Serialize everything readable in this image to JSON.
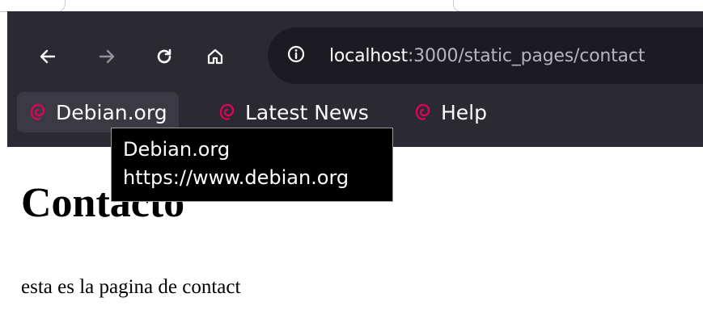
{
  "toolbar": {
    "back_icon": "arrow-left-icon",
    "forward_icon": "arrow-right-icon",
    "reload_icon": "reload-icon",
    "home_icon": "home-icon",
    "site_info_icon": "info-icon"
  },
  "urlbar": {
    "host": "localhost",
    "rest": ":3000/static_pages/contact"
  },
  "bookmarks": [
    {
      "label": "Debian.org",
      "icon": "debian-swirl-icon"
    },
    {
      "label": "Latest News",
      "icon": "debian-swirl-icon"
    },
    {
      "label": "Help",
      "icon": "debian-swirl-icon"
    }
  ],
  "tooltip": {
    "line1": "Debian.org",
    "line2": "https://www.debian.org"
  },
  "page": {
    "title": "Contacto",
    "body": "esta es la pagina de contact"
  },
  "colors": {
    "chrome_bg": "#2b2a33",
    "urlbar_bg": "#1c1b22",
    "debian_red": "#d70751"
  }
}
